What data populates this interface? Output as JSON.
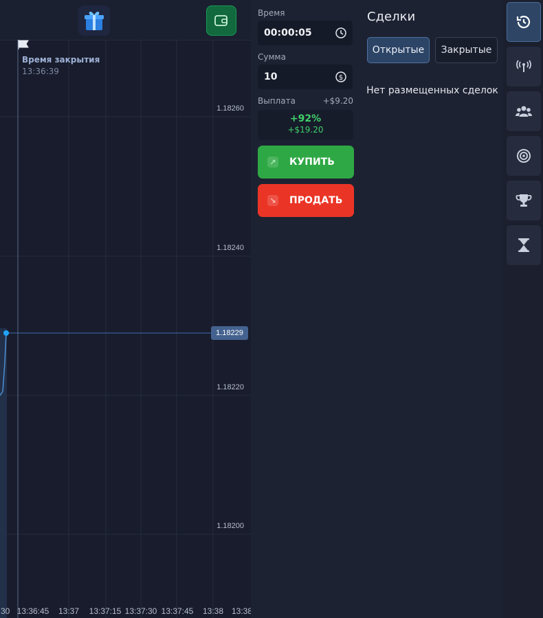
{
  "chart": {
    "close_time_title": "Время закрытия",
    "close_time_value": "13:36:39",
    "current_price": "1.18229",
    "price_labels": [
      "1.18260",
      "1.18240",
      "1.18220",
      "1.18200"
    ],
    "time_labels": [
      ":30",
      "13:36:45",
      "13:37",
      "13:37:15",
      "13:37:30",
      "13:37:45",
      "13:38",
      "13:38"
    ]
  },
  "trade": {
    "time_label": "Время",
    "time_value": "00:00:05",
    "amount_label": "Сумма",
    "amount_value": "10",
    "payout_label": "Выплата",
    "payout_profit": "+$9.20",
    "payout_percent": "+92%",
    "payout_total": "+$19.20",
    "buy_label": "КУПИТЬ",
    "sell_label": "ПРОДАТЬ"
  },
  "deals": {
    "title": "Сделки",
    "tab_open": "Открытые",
    "tab_closed": "Закрытые",
    "empty_message": "Нет размещенных сделок"
  },
  "sidebar": {
    "items": [
      "history-icon",
      "signal-icon",
      "social-icon",
      "target-icon",
      "trophy-icon",
      "hourglass-icon"
    ]
  },
  "colors": {
    "buy": "#2ea844",
    "sell": "#ea3526",
    "accent": "#44628f",
    "line": "#1fa4ff"
  }
}
